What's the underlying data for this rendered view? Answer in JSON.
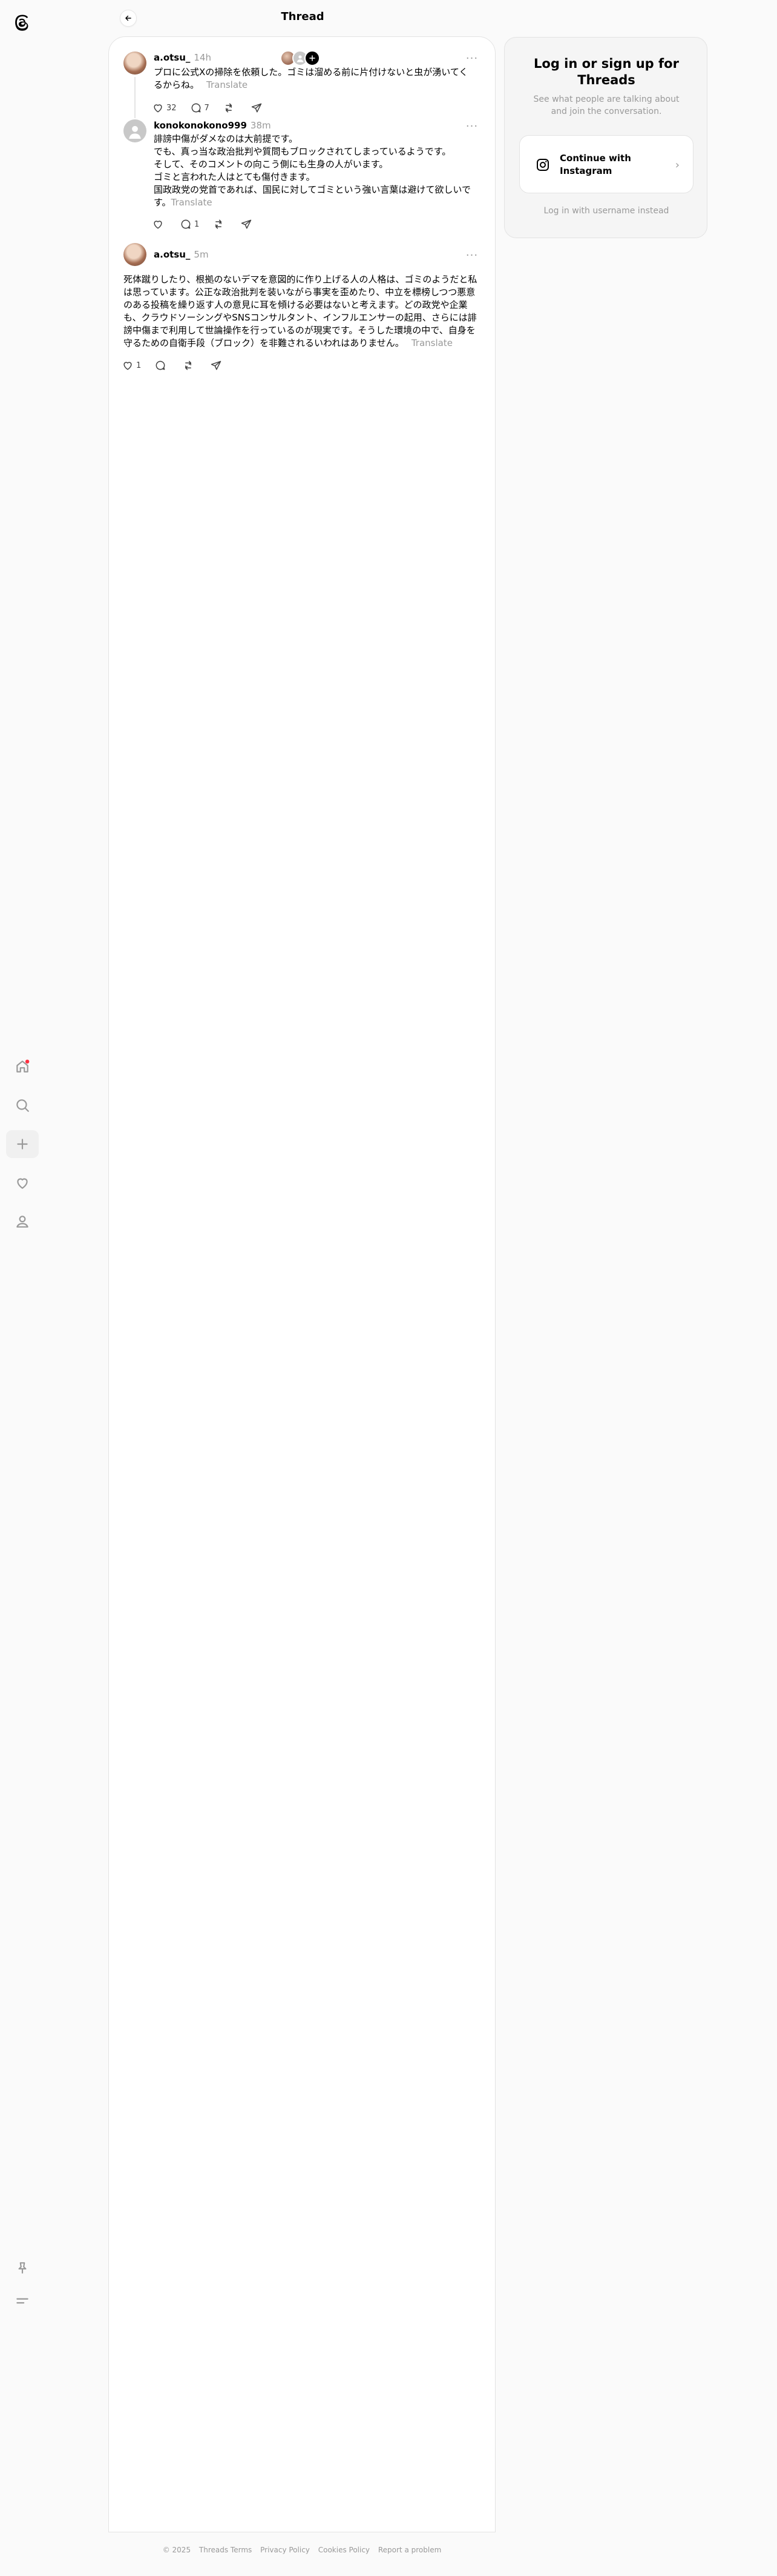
{
  "header": {
    "title": "Thread"
  },
  "posts": [
    {
      "username": "a.otsu_",
      "time": "14h",
      "text": "プロに公式Xの掃除を依頼した。ゴミは溜める前に片付けないと虫が湧いてくるからね。",
      "translate": "Translate",
      "likes": "32",
      "replies": "7",
      "reposts": "",
      "shares": ""
    },
    {
      "username": "konokonokono999",
      "time": "38m",
      "lines": [
        "誹謗中傷がダメなのは大前提です。",
        "でも、真っ当な政治批判や質問もブロックされてしまっているようです。",
        "そして、そのコメントの向こう側にも生身の人がいます。",
        "ゴミと言われた人はとても傷付きます。",
        "国政政党の党首であれば、国民に対してゴミという強い言葉は避けて欲しいです。"
      ],
      "translate": "Translate",
      "likes": "",
      "replies": "1",
      "reposts": "",
      "shares": ""
    },
    {
      "username": "a.otsu_",
      "time": "5m",
      "text": "死体蹴りしたり、根拠のないデマを意図的に作り上げる人の人格は、ゴミのようだと私は思っています。公正な政治批判を装いながら事実を歪めたり、中立を標榜しつつ悪意のある投稿を繰り返す人の意見に耳を傾ける必要はないと考えます。どの政党や企業も、クラウドソーシングやSNSコンサルタント、インフルエンサーの起用、さらには誹謗中傷まで利用して世論操作を行っているのが現実です。そうした環境の中で、自身を守るための自衛手段（ブロック）を非難されるいわれはありません。",
      "translate": "Translate",
      "likes": "1",
      "replies": "",
      "reposts": "",
      "shares": ""
    }
  ],
  "login": {
    "title": "Log in or sign up for Threads",
    "subtitle": "See what people are talking about and join the conversation.",
    "instagram_button": "Continue with Instagram",
    "username_link": "Log in with username instead"
  },
  "footer": {
    "copyright": "© 2025",
    "terms": "Threads Terms",
    "privacy": "Privacy Policy",
    "cookies": "Cookies Policy",
    "report": "Report a problem"
  },
  "icons": {
    "logo": "threads-logo-icon",
    "home": "home-icon",
    "search": "search-icon",
    "create": "plus-icon",
    "activity": "heart-icon",
    "profile": "profile-icon",
    "pin": "pin-icon",
    "menu": "menu-icon",
    "back": "arrow-left-icon"
  },
  "colors": {
    "notification_dot": "#ff3040",
    "muted_text": "#999999",
    "border": "#e3e3e3"
  }
}
